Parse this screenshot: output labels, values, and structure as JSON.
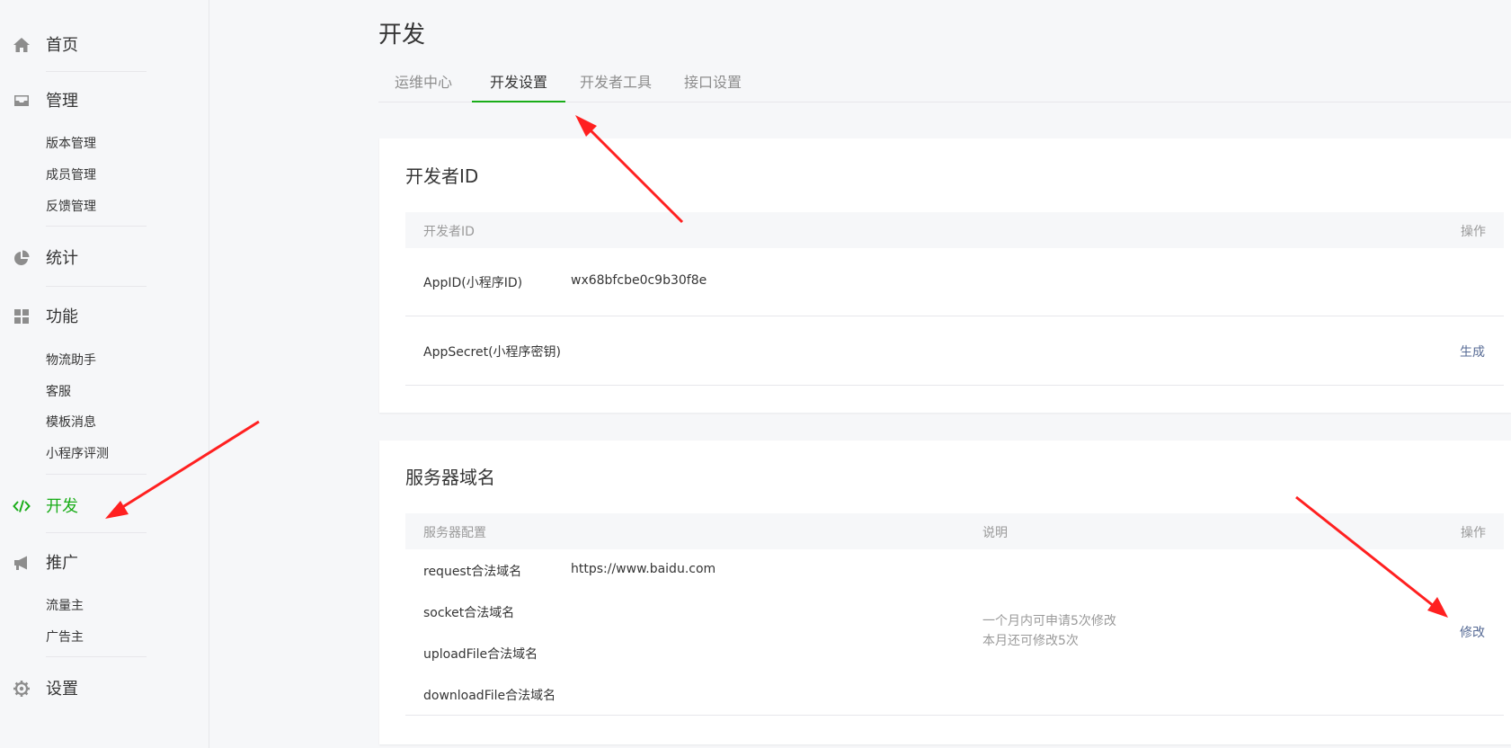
{
  "sidebar": {
    "home": {
      "label": "首页",
      "icon": "home-icon"
    },
    "manage": {
      "label": "管理",
      "icon": "inbox-icon",
      "items": [
        "版本管理",
        "成员管理",
        "反馈管理"
      ]
    },
    "stats": {
      "label": "统计",
      "icon": "pie-chart-icon"
    },
    "features": {
      "label": "功能",
      "icon": "grid-icon",
      "items": [
        "物流助手",
        "客服",
        "模板消息",
        "小程序评测"
      ]
    },
    "develop": {
      "label": "开发",
      "icon": "code-icon"
    },
    "promote": {
      "label": "推广",
      "icon": "megaphone-icon",
      "items": [
        "流量主",
        "广告主"
      ]
    },
    "settings": {
      "label": "设置",
      "icon": "gear-icon"
    }
  },
  "page": {
    "title": "开发"
  },
  "tabs": [
    "运维中心",
    "开发设置",
    "开发者工具",
    "接口设置"
  ],
  "developer_id": {
    "title": "开发者ID",
    "header": {
      "col1": "开发者ID",
      "action": "操作"
    },
    "appid_label": "AppID(小程序ID)",
    "appid_value": "wx68bfcbe0c9b30f8e",
    "secret_label": "AppSecret(小程序密钥)",
    "secret_action": "生成"
  },
  "server_domain": {
    "title": "服务器域名",
    "header": {
      "col1": "服务器配置",
      "col2": "说明",
      "action": "操作"
    },
    "request_label": "request合法域名",
    "request_value": "https://www.baidu.com",
    "socket_label": "socket合法域名",
    "upload_label": "uploadFile合法域名",
    "download_label": "downloadFile合法域名",
    "note_line1": "一个月内可申请5次修改",
    "note_line2": "本月还可修改5次",
    "action": "修改"
  },
  "colors": {
    "accent": "#1aad19",
    "link": "#576b95",
    "annotation_arrow": "#ff2020"
  }
}
